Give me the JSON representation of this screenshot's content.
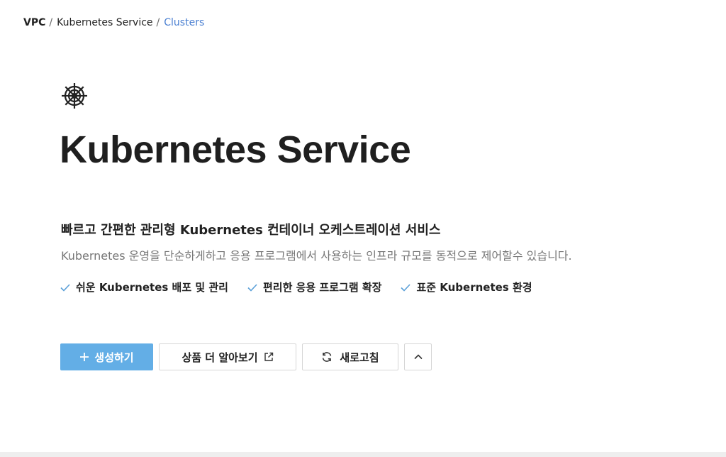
{
  "breadcrumb": {
    "items": [
      "VPC",
      "Kubernetes Service",
      "Clusters"
    ],
    "separator": "/"
  },
  "hero": {
    "icon": "helm-wheel-icon",
    "title": "Kubernetes Service",
    "subtitle": "빠르고 간편한 관리형 Kubernetes 컨테이너 오케스트레이션 서비스",
    "description": "Kubernetes 운영을 단순하게하고 응용 프로그램에서 사용하는 인프라 규모를 동적으로 제어할수 있습니다."
  },
  "features": [
    {
      "icon": "check-icon",
      "label": "쉬운 Kubernetes 배포 및 관리"
    },
    {
      "icon": "check-icon",
      "label": "편리한 응용 프로그램 확장"
    },
    {
      "icon": "check-icon",
      "label": "표준 Kubernetes 환경"
    }
  ],
  "actions": {
    "create_label": "생성하기",
    "learn_more_label": "상품 더 알아보기",
    "refresh_label": "새로고침"
  },
  "colors": {
    "primary": "#63aee6",
    "link": "#4a7fd1",
    "check": "#5a9fd8",
    "text": "#222222",
    "muted": "#777777"
  }
}
